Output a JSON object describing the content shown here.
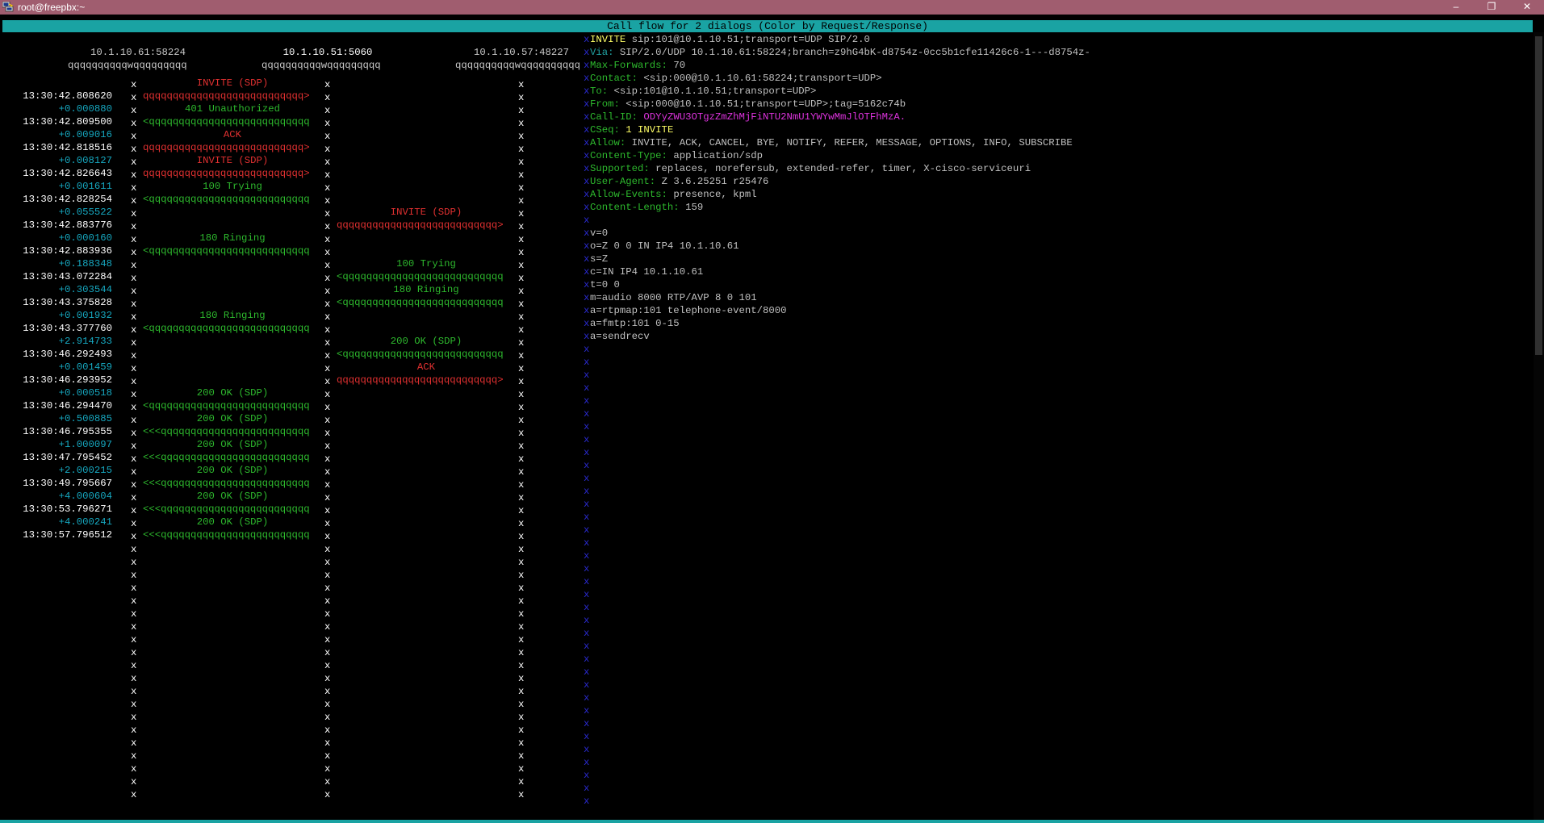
{
  "window": {
    "title": "root@freepbx:~",
    "buttons": {
      "minimize": "–",
      "maximize": "❐",
      "close": "✕"
    }
  },
  "header": {
    "title": "Call flow for 2 dialogs (Color by Request/Response)"
  },
  "columns": [
    {
      "address": "10.1.10.61:58224"
    },
    {
      "address": "10.1.10.51:5060"
    },
    {
      "address": "10.1.10.57:48227"
    }
  ],
  "column_rule": "qqqqqqqqqqwqqqqqqqqq",
  "column_rule_last": "qqqqqqqqqqwqqqqqqqqqq",
  "lifeline_char": "x",
  "arrow_body": "qqqqqqqqqqqqqqqqqqqqqqqqqqq",
  "arrow_body_short": "qqqqqqqqqqqqqqqqqqqqqqqqq",
  "messages": [
    {
      "time": "13:30:42.808620",
      "delta": "+0.000880",
      "label": "INVITE (SDP)",
      "kind": "request",
      "from": 0,
      "to": 1
    },
    {
      "time": "13:30:42.809500",
      "delta": "+0.009016",
      "label": "401 Unauthorized",
      "kind": "response",
      "from": 1,
      "to": 0
    },
    {
      "time": "13:30:42.818516",
      "delta": "+0.008127",
      "label": "ACK",
      "kind": "request",
      "from": 0,
      "to": 1
    },
    {
      "time": "13:30:42.826643",
      "delta": "+0.001611",
      "label": "INVITE (SDP)",
      "kind": "request",
      "from": 0,
      "to": 1
    },
    {
      "time": "13:30:42.828254",
      "delta": "+0.055522",
      "label": "100 Trying",
      "kind": "response",
      "from": 1,
      "to": 0
    },
    {
      "time": "13:30:42.883776",
      "delta": "+0.000160",
      "label": "INVITE (SDP)",
      "kind": "request",
      "from": 1,
      "to": 2
    },
    {
      "time": "13:30:42.883936",
      "delta": "+0.188348",
      "label": "180 Ringing",
      "kind": "response",
      "from": 1,
      "to": 0
    },
    {
      "time": "13:30:43.072284",
      "delta": "+0.303544",
      "label": "100 Trying",
      "kind": "response",
      "from": 2,
      "to": 1
    },
    {
      "time": "13:30:43.375828",
      "delta": "+0.001932",
      "label": "180 Ringing",
      "kind": "response",
      "from": 2,
      "to": 1
    },
    {
      "time": "13:30:43.377760",
      "delta": "+2.914733",
      "label": "180 Ringing",
      "kind": "response",
      "from": 1,
      "to": 0
    },
    {
      "time": "13:30:46.292493",
      "delta": "+0.001459",
      "label": "200 OK (SDP)",
      "kind": "response",
      "from": 2,
      "to": 1
    },
    {
      "time": "13:30:46.293952",
      "delta": "+0.000518",
      "label": "ACK",
      "kind": "request",
      "from": 1,
      "to": 2
    },
    {
      "time": "13:30:46.294470",
      "delta": "+0.500885",
      "label": "200 OK (SDP)",
      "kind": "response",
      "from": 1,
      "to": 0
    },
    {
      "time": "13:30:46.795355",
      "delta": "+1.000097",
      "label": "200 OK (SDP)",
      "kind": "response",
      "from": 1,
      "to": 0,
      "retrans": true
    },
    {
      "time": "13:30:47.795452",
      "delta": "+2.000215",
      "label": "200 OK (SDP)",
      "kind": "response",
      "from": 1,
      "to": 0,
      "retrans": true
    },
    {
      "time": "13:30:49.795667",
      "delta": "+4.000604",
      "label": "200 OK (SDP)",
      "kind": "response",
      "from": 1,
      "to": 0,
      "retrans": true
    },
    {
      "time": "13:30:53.796271",
      "delta": "+4.000241",
      "label": "200 OK (SDP)",
      "kind": "response",
      "from": 1,
      "to": 0,
      "retrans": true
    },
    {
      "time": "13:30:57.796512",
      "label": "200 OK (SDP)",
      "kind": "response",
      "from": 1,
      "to": 0,
      "retrans": true
    }
  ],
  "detail": [
    {
      "text": "INVITE",
      "rest": " sip:101@10.1.10.51;transport=UDP SIP/2.0",
      "style": "req"
    },
    {
      "text": "Via:",
      "rest": " SIP/2.0/UDP 10.1.10.61:58224;branch=z9hG4bK-d8754z-0cc5b1cfe11426c6-1---d8754z-",
      "style": "via"
    },
    {
      "text": "Max-Forwards:",
      "rest": " 70",
      "style": "hdr"
    },
    {
      "text": "Contact:",
      "rest": " <sip:000@10.1.10.61:58224;transport=UDP>",
      "style": "hdr"
    },
    {
      "text": "To:",
      "rest": " <sip:101@10.1.10.51;transport=UDP>",
      "style": "hdr"
    },
    {
      "text": "From:",
      "rest": " <sip:000@10.1.10.51;transport=UDP>;tag=5162c74b",
      "style": "hdr"
    },
    {
      "text": "Call-ID:",
      "rest": " ODYyZWU3OTgzZmZhMjFiNTU2NmU1YWYwMmJlOTFhMzA.",
      "style": "callid"
    },
    {
      "text": "CSeq:",
      "rest": " 1 INVITE",
      "style": "cseq"
    },
    {
      "text": "Allow:",
      "rest": " INVITE, ACK, CANCEL, BYE, NOTIFY, REFER, MESSAGE, OPTIONS, INFO, SUBSCRIBE",
      "style": "hdr"
    },
    {
      "text": "Content-Type:",
      "rest": " application/sdp",
      "style": "hdr"
    },
    {
      "text": "Supported:",
      "rest": " replaces, norefersub, extended-refer, timer, X-cisco-serviceuri",
      "style": "hdr"
    },
    {
      "text": "User-Agent:",
      "rest": " Z 3.6.25251 r25476",
      "style": "hdr"
    },
    {
      "text": "Allow-Events:",
      "rest": " presence, kpml",
      "style": "hdr"
    },
    {
      "text": "Content-Length:",
      "rest": " 159",
      "style": "hdr"
    },
    {
      "text": "",
      "rest": "",
      "style": "plain"
    },
    {
      "text": "v=0",
      "rest": "",
      "style": "plain"
    },
    {
      "text": "o=Z 0 0 IN IP4 10.1.10.61",
      "rest": "",
      "style": "plain"
    },
    {
      "text": "s=Z",
      "rest": "",
      "style": "plain"
    },
    {
      "text": "c=IN IP4 10.1.10.61",
      "rest": "",
      "style": "plain"
    },
    {
      "text": "t=0 0",
      "rest": "",
      "style": "plain"
    },
    {
      "text": "m=audio 8000 RTP/AVP 8 0 101",
      "rest": "",
      "style": "plain"
    },
    {
      "text": "a=rtpmap:101 telephone-event/8000",
      "rest": "",
      "style": "plain"
    },
    {
      "text": "a=fmtp:101 0-15",
      "rest": "",
      "style": "plain"
    },
    {
      "text": "a=sendrecv",
      "rest": "",
      "style": "plain"
    }
  ]
}
